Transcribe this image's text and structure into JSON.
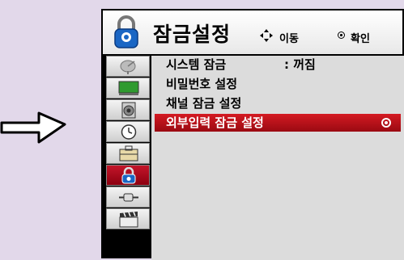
{
  "header": {
    "title": "잠금설정",
    "hint_move_label": "이동",
    "hint_ok_label": "확인"
  },
  "sidebar": {
    "items": [
      {
        "icon": "satellite-dish-icon"
      },
      {
        "icon": "tv-monitor-icon"
      },
      {
        "icon": "speaker-icon"
      },
      {
        "icon": "clock-icon"
      },
      {
        "icon": "toolbox-icon"
      },
      {
        "icon": "padlock-icon",
        "active": true
      },
      {
        "icon": "cable-plug-icon"
      },
      {
        "icon": "clapperboard-icon"
      }
    ]
  },
  "menu": {
    "items": [
      {
        "label": "시스템 잠금",
        "value": ": 꺼짐"
      },
      {
        "label": "비밀번호 설정"
      },
      {
        "label": "채널 잠금 설정"
      },
      {
        "label": "외부입력 잠금 설정",
        "selected": true
      }
    ]
  },
  "colors": {
    "background": "#e2d8ea",
    "selected_row": "#c0141c",
    "active_sidebar": "#b01020",
    "menu_panel": "#dcdcdc"
  }
}
